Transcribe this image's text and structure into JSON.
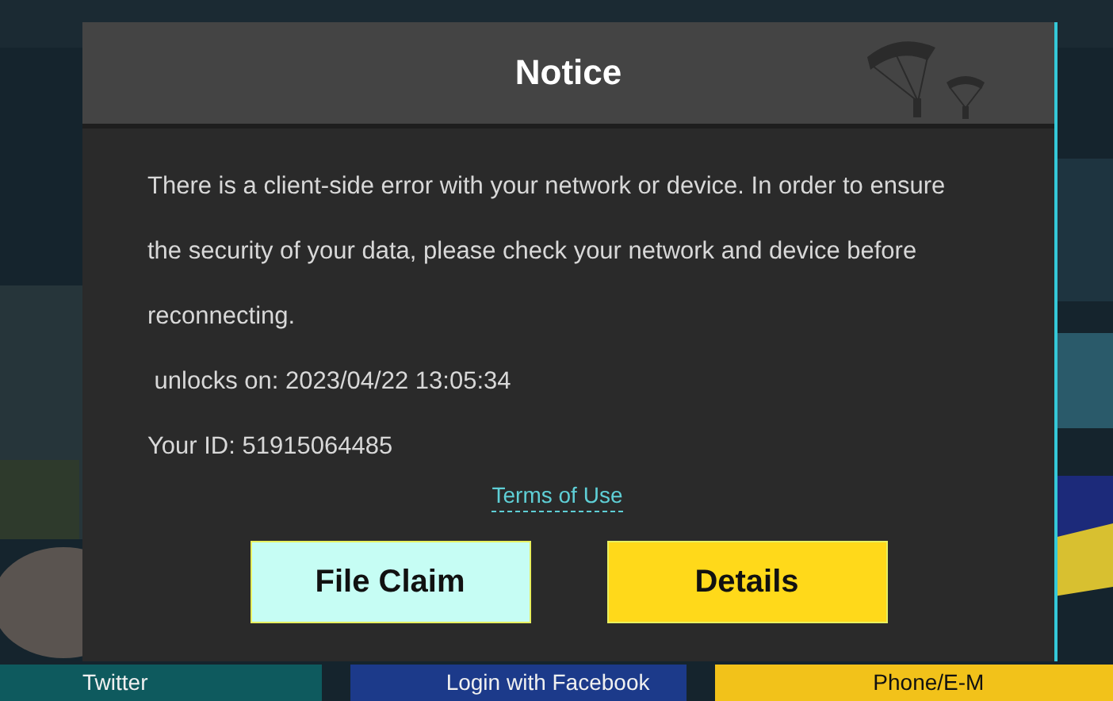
{
  "login_options": [
    {
      "label": "Twitter",
      "color": "#0e5a5e"
    },
    {
      "label": "Login with Facebook",
      "color": "#1c3a8a"
    },
    {
      "label": "Phone/E-M",
      "color": "#f2c21a"
    }
  ],
  "dialog": {
    "title": "Notice",
    "message": "There is a client-side error with your network or device. In order to ensure the security of your data, please check your network and device before reconnecting.",
    "unlock": " unlocks on: 2023/04/22 13:05:34",
    "user_id": "Your ID: 51915064485",
    "link": "Terms of Use",
    "buttons": [
      {
        "label": "File Claim",
        "kind": "secondary"
      },
      {
        "label": "Details",
        "kind": "primary"
      }
    ]
  }
}
